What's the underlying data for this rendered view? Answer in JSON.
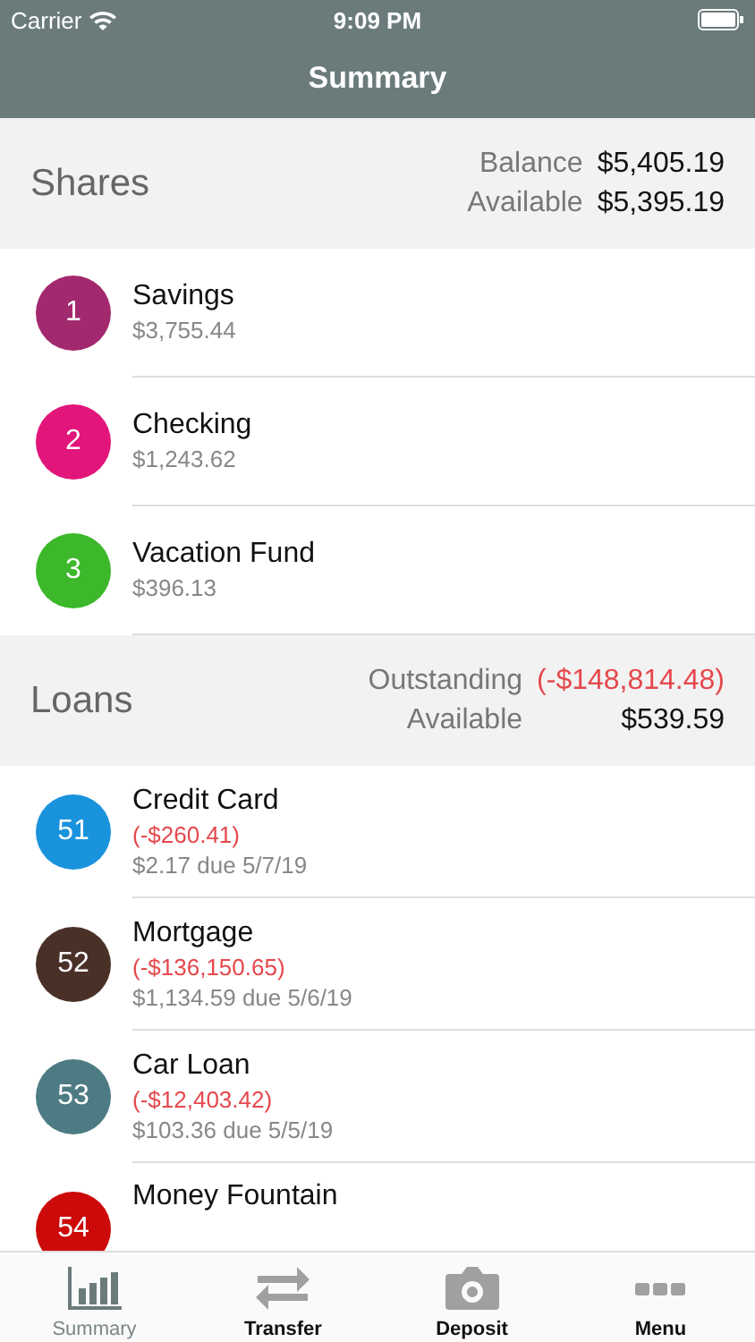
{
  "status_bar": {
    "carrier": "Carrier",
    "time": "9:09 PM"
  },
  "nav_bar": {
    "title": "Summary"
  },
  "sections": [
    {
      "title": "Shares",
      "totals": [
        {
          "label": "Balance",
          "value": "$5,405.19",
          "negative": false
        },
        {
          "label": "Available",
          "value": "$5,395.19",
          "negative": false
        }
      ],
      "accounts": [
        {
          "number": "1",
          "name": "Savings",
          "color": "#a3296e",
          "lines": [
            {
              "text": "$3,755.44",
              "negative": false
            }
          ]
        },
        {
          "number": "2",
          "name": "Checking",
          "color": "#e2157a",
          "lines": [
            {
              "text": "$1,243.62",
              "negative": false
            }
          ]
        },
        {
          "number": "3",
          "name": "Vacation Fund",
          "color": "#3cb82a",
          "lines": [
            {
              "text": "$396.13",
              "negative": false
            }
          ]
        }
      ]
    },
    {
      "title": "Loans",
      "totals": [
        {
          "label": "Outstanding",
          "value": "(-$148,814.48)",
          "negative": true
        },
        {
          "label": "Available",
          "value": "$539.59",
          "negative": false
        }
      ],
      "accounts": [
        {
          "number": "51",
          "name": "Credit Card",
          "color": "#1a93dd",
          "lines": [
            {
              "text": "(-$260.41)",
              "negative": true
            },
            {
              "text": "$2.17 due 5/7/19",
              "negative": false
            }
          ]
        },
        {
          "number": "52",
          "name": "Mortgage",
          "color": "#4a3128",
          "lines": [
            {
              "text": "(-$136,150.65)",
              "negative": true
            },
            {
              "text": "$1,134.59 due 5/6/19",
              "negative": false
            }
          ]
        },
        {
          "number": "53",
          "name": "Car Loan",
          "color": "#4d7b84",
          "lines": [
            {
              "text": "(-$12,403.42)",
              "negative": true
            },
            {
              "text": "$103.36 due 5/5/19",
              "negative": false
            }
          ]
        },
        {
          "number": "54",
          "name": "Money Fountain",
          "color": "#cc0a0a"
        }
      ]
    }
  ],
  "tab_bar": [
    {
      "label": "Summary",
      "selected": true
    },
    {
      "label": "Transfer",
      "selected": false
    },
    {
      "label": "Deposit",
      "selected": false
    },
    {
      "label": "Menu",
      "selected": false
    }
  ]
}
